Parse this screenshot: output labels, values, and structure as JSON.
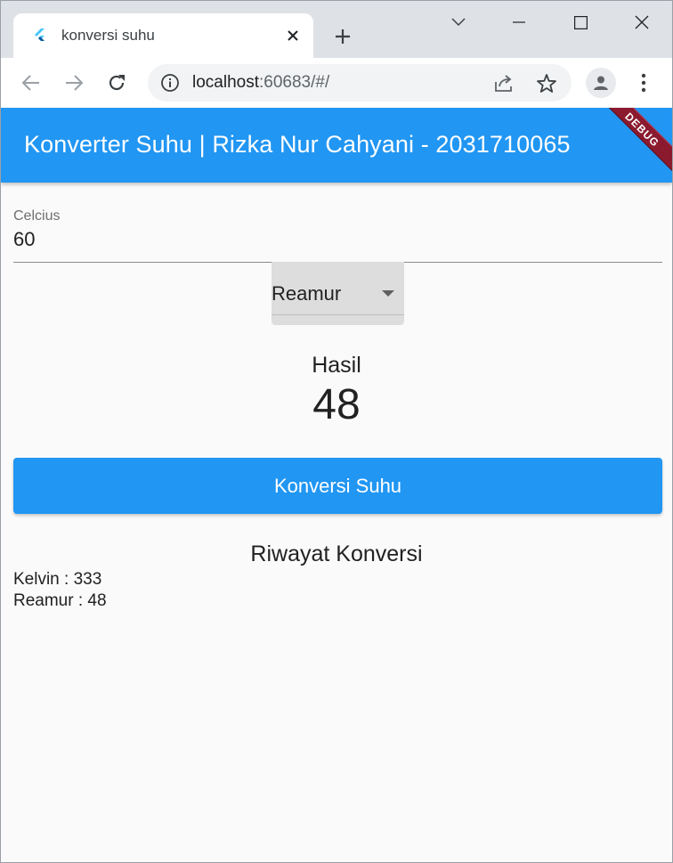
{
  "browser": {
    "tab_title": "konversi suhu",
    "url_host": "localhost",
    "url_rest": ":60683/#/"
  },
  "app": {
    "title": "Konverter Suhu | Rizka Nur Cahyani - 2031710065",
    "debug_banner": "DEBUG",
    "primary_color": "#2196f3",
    "input": {
      "label": "Celcius",
      "value": "60"
    },
    "dropdown": {
      "selected": "Reamur"
    },
    "result": {
      "label": "Hasil",
      "value": "48"
    },
    "convert_button": "Konversi Suhu",
    "history": {
      "title": "Riwayat Konversi",
      "items": [
        "Kelvin : 333",
        "Reamur : 48"
      ]
    }
  }
}
